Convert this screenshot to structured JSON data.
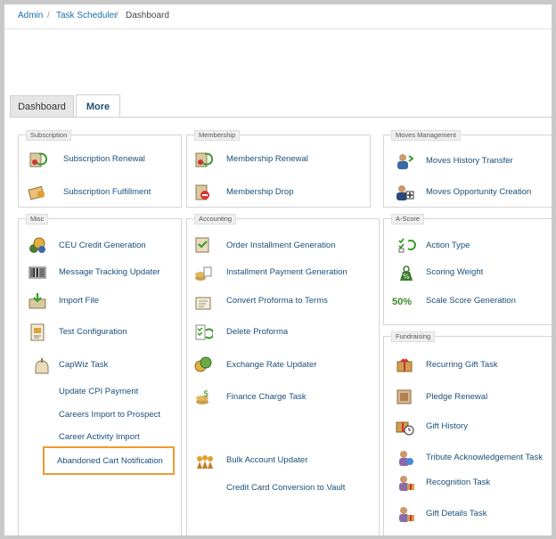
{
  "breadcrumb": {
    "items": [
      "Admin",
      "Task Scheduler",
      "Dashboard"
    ],
    "separator": "/"
  },
  "tabs": {
    "dashboard": "Dashboard",
    "more": "More"
  },
  "panels": {
    "subscription": {
      "title": "Subscription",
      "items": [
        "Subscription Renewal",
        "Subscription Fulfillment"
      ]
    },
    "membership": {
      "title": "Membership",
      "items": [
        "Membership Renewal",
        "Membership Drop"
      ]
    },
    "moves": {
      "title": "Moves Management",
      "items": [
        "Moves History Transfer",
        "Moves Opportunity Creation"
      ]
    },
    "misc": {
      "title": "Misc",
      "items": [
        "CEU Credit Generation",
        "Message Tracking Updater",
        "Import File",
        "Test Configuration",
        "CapWiz Task",
        "Update CPI Payment",
        "Careers Import to Prospect",
        "Career Activity Import",
        "Abandoned Cart Notification"
      ]
    },
    "accounting": {
      "title": "Accounting",
      "items": [
        "Order Installment Generation",
        "Installment Payment Generation",
        "Convert Proforma to Terms",
        "Delete Proforma",
        "Exchange Rate Updater",
        "Finance Charge Task",
        "Bulk Account Updater",
        "Credit Card Conversion to Vault"
      ]
    },
    "ascore": {
      "title": "A-Score",
      "items": [
        "Action Type",
        "Scoring Weight",
        "Scale Score Generation"
      ],
      "score_badge": "50%"
    },
    "fundraising": {
      "title": "Fundraising",
      "items": [
        "Recurring Gift Task",
        "Pledge Renewal",
        "Gift History",
        "Tribute Acknowledgement Task",
        "Recognition Task",
        "Gift Details Task"
      ]
    }
  },
  "colors": {
    "link": "#1a4f7a",
    "highlight": "#f29a2e",
    "panel_border": "#d5d5d5"
  }
}
